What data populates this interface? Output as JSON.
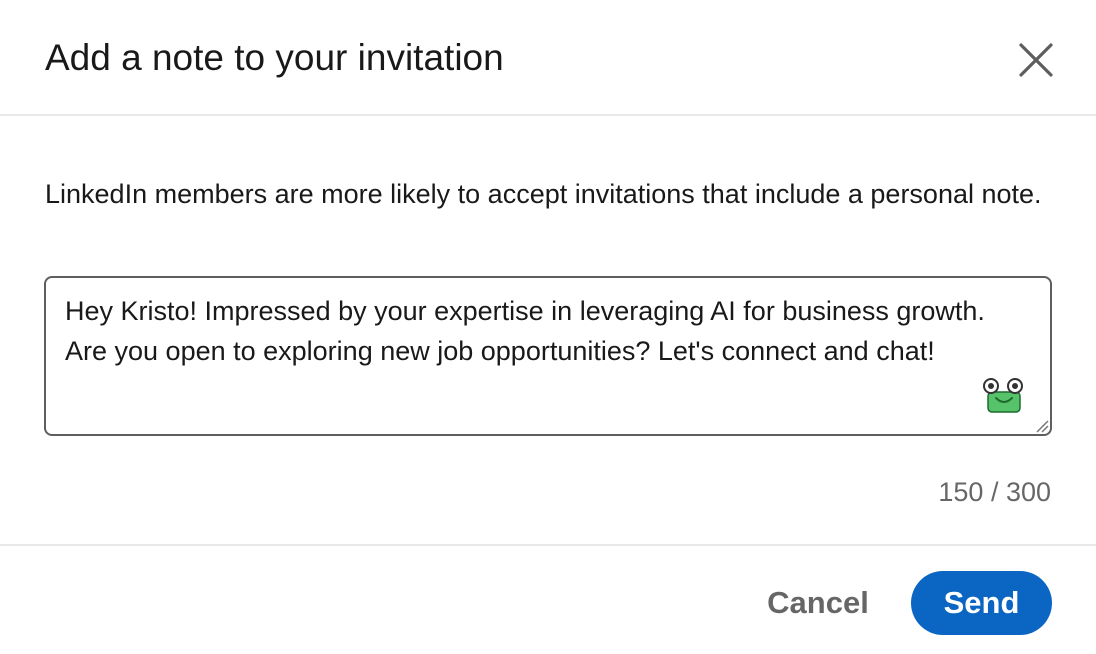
{
  "dialog": {
    "title": "Add a note to your invitation",
    "close_icon": "close-icon"
  },
  "body": {
    "hint": "LinkedIn members are more likely to accept invitations that include a personal note."
  },
  "note": {
    "value": "Hey Kristo! Impressed by your expertise in leveraging AI for business growth. Are you open to exploring new job opportunities? Let's connect and chat!",
    "assist_icon": "ai-assistant-icon",
    "char_count": 150,
    "char_limit": 300,
    "counter_text": "150 / 300"
  },
  "footer": {
    "cancel_label": "Cancel",
    "send_label": "Send"
  },
  "colors": {
    "accent": "#0a66c2",
    "assist_green": "#56c26a",
    "border": "#5e5e5e",
    "divider": "#e8e8e8"
  }
}
